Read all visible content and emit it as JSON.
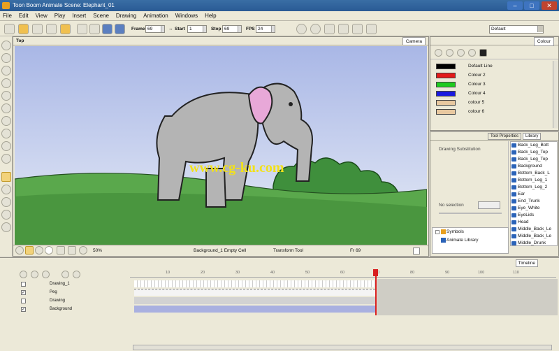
{
  "window": {
    "title": "Toon Boom Animate Scene: Elephant_01"
  },
  "menu": [
    "File",
    "Edit",
    "View",
    "Play",
    "Insert",
    "Scene",
    "Drawing",
    "Animation",
    "Windows",
    "Help"
  ],
  "toolbar": {
    "frame_label": "Frame",
    "frame_value": "69",
    "start_label": "Start",
    "start_value": "1",
    "stop_label": "Stop",
    "stop_value": "69",
    "fps_label": "FPS",
    "fps_value": "24",
    "workspace_value": "Default"
  },
  "camera": {
    "view_name": "Top",
    "tab_label": "Camera",
    "zoom": "50%",
    "status_cell": "Background_1 Empty Cell",
    "status_tool": "Transform Tool",
    "status_frame": "Fr 69",
    "watermark": "www.cg-ku.com"
  },
  "colour_panel": {
    "tab_label": "Colour",
    "swatches": [
      {
        "name": "Default Line",
        "color": "#000000"
      },
      {
        "name": "Colour 2",
        "color": "#e31a1a"
      },
      {
        "name": "Colour 3",
        "color": "#1ecb1e"
      },
      {
        "name": "Colour 4",
        "color": "#1a1ae0"
      },
      {
        "name": "colour 5",
        "color": "#e8c8a0"
      },
      {
        "name": "colour 6",
        "color": "#e8c8a0"
      }
    ]
  },
  "library_panel": {
    "tab_tool_properties": "Tool Properties",
    "tab_library": "Library",
    "drawing_substitution": "Drawing Substitution",
    "no_selection": "No selection",
    "items": [
      "Back_Leg_Bott",
      "Back_Leg_Top",
      "Back_Leg_Top",
      "Background",
      "Bottom_Back_L",
      "Bottom_Leg_1",
      "Bottom_Leg_2",
      "Ear",
      "End_Trunk",
      "Eye_White",
      "EyeLids",
      "Head",
      "Middle_Back_Le",
      "Middle_Back_Le",
      "Middle_Drunk"
    ],
    "tree": [
      "Symbols",
      "Animate Library"
    ]
  },
  "timeline": {
    "tab_label": "Timeline",
    "layers": [
      {
        "name": "Drawing_1"
      },
      {
        "name": "Peg"
      },
      {
        "name": "Drawing"
      },
      {
        "name": "Background"
      }
    ],
    "ruler": [
      "10",
      "20",
      "30",
      "40",
      "50",
      "60",
      "70",
      "80",
      "90",
      "100",
      "110"
    ],
    "current_frame": "69"
  }
}
